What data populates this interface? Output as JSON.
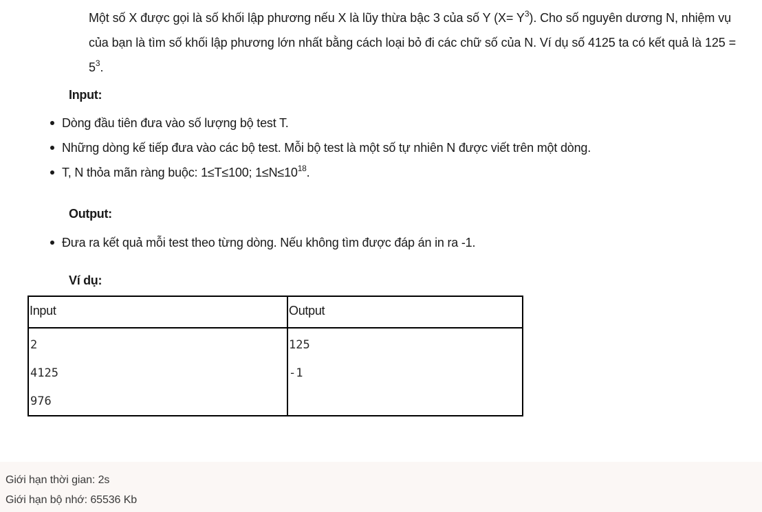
{
  "problem": {
    "intro_line1_a": "Một số X được gọi là số khối lập phương nếu X là lũy thừa bậc 3 của số Y (X= Y",
    "intro_line1_sup": "3",
    "intro_line1_b": "). Cho số nguyên dương N, nhiệm vụ",
    "intro_line2": "của bạn là tìm số khối lập phương lớn nhất bằng cách loại bỏ đi các chữ số của N. Ví dụ số 4125 ta có kết quả là 125 =",
    "intro_line3_base": "5",
    "intro_line3_sup": "3",
    "intro_line3_end": "."
  },
  "input_section": {
    "heading": "Input:",
    "bullet1": "Dòng đầu tiên đưa vào số lượng bộ test T.",
    "bullet2": "Những dòng kế tiếp đưa vào các bộ test. Mỗi bộ test là một số tự nhiên N được viết trên một dòng.",
    "bullet3_a": "T, N thỏa mãn ràng buộc: 1≤T≤100;  1≤N≤10",
    "bullet3_sup": "18",
    "bullet3_end": "."
  },
  "output_section": {
    "heading": "Output:",
    "bullet1": "Đưa ra kết quả mỗi test theo từng dòng. Nếu không tìm được đáp án in ra -1."
  },
  "example": {
    "heading": "Ví dụ:",
    "col_input": "Input",
    "col_output": "Output",
    "input_lines": [
      "2",
      "4125",
      "976"
    ],
    "output_lines": [
      "125",
      "-1"
    ]
  },
  "limits": {
    "time": "Giới hạn thời gian: 2s",
    "memory": "Giới hạn bộ nhớ: 65536 Kb"
  }
}
